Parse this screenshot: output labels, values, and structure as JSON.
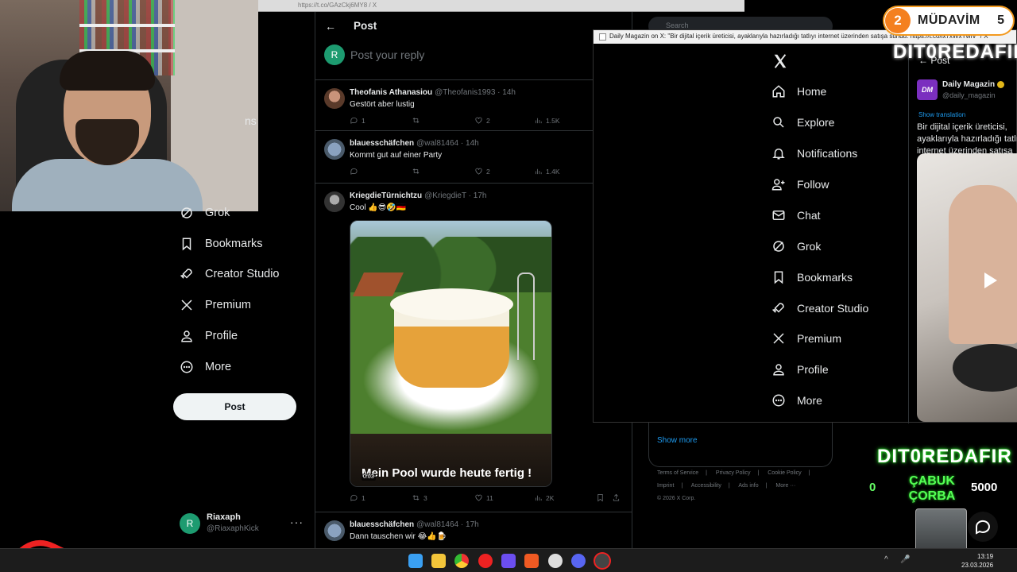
{
  "browser": {
    "url": "https://t.co/GAzCkj6MY8 / X"
  },
  "left_nav": {
    "partial_item": "ns",
    "items": [
      {
        "label": "Grok",
        "icon": "grok-icon"
      },
      {
        "label": "Bookmarks",
        "icon": "bookmark-icon"
      },
      {
        "label": "Creator Studio",
        "icon": "rocket-icon"
      },
      {
        "label": "Premium",
        "icon": "x-logo-icon"
      },
      {
        "label": "Profile",
        "icon": "person-icon"
      },
      {
        "label": "More",
        "icon": "more-circle-icon"
      }
    ],
    "post_button": "Post",
    "account": {
      "avatar_letter": "R",
      "name": "Riaxaph",
      "handle": "@RiaxaphKick",
      "more": "···"
    }
  },
  "timeline": {
    "back": "←",
    "title": "Post",
    "reply": {
      "avatar_letter": "R",
      "placeholder": "Post your reply"
    },
    "tweets": [
      {
        "name": "Theofanis Athanasiou",
        "meta": "@Theofanis1993 · 14h",
        "text": "Gestört aber lustig",
        "replies": "1",
        "retweets": "",
        "likes": "2",
        "views": "1.5K"
      },
      {
        "name": "blauesschäfchen",
        "meta": "@wal81464 · 14h",
        "text": "Kommt gut auf einer Party",
        "replies": "",
        "retweets": "",
        "likes": "2",
        "views": "1.4K"
      },
      {
        "name": "KriegdieTürnichtzu",
        "meta": "@KriegdieT · 17h",
        "text": "Cool 👍😎🤣🇩🇪",
        "media_caption": "Mein Pool wurde heute fertig !",
        "media_time": "0:03",
        "replies": "1",
        "retweets": "3",
        "likes": "11",
        "views": "2K"
      },
      {
        "name": "blauesschäfchen",
        "meta": "@wal81464 · 17h",
        "text": "Dann tauschen wir 😂👍🍺"
      }
    ]
  },
  "right_col": {
    "search_placeholder": "Search",
    "show_more": "Show more",
    "footer": [
      "Terms of Service",
      "|",
      "Privacy Policy",
      "|",
      "Cookie Policy",
      "|",
      "Imprint",
      "|",
      "Accessibility",
      "|",
      "Ads info",
      "|",
      "More ···",
      "© 2026 X Corp."
    ]
  },
  "popup": {
    "title": "Daily Magazin on X: \"Bir dijital içerik üreticisi, ayaklarıyla hazırladığı tatlıyı internet üzerinden satışa sundu. https://t.co/ix7xWxYwiV\" / X",
    "nav": [
      {
        "label": "Home",
        "icon": "home-icon"
      },
      {
        "label": "Explore",
        "icon": "search-icon"
      },
      {
        "label": "Notifications",
        "icon": "bell-icon"
      },
      {
        "label": "Follow",
        "icon": "person-add-icon"
      },
      {
        "label": "Chat",
        "icon": "mail-icon"
      },
      {
        "label": "Grok",
        "icon": "grok-icon"
      },
      {
        "label": "Bookmarks",
        "icon": "bookmark-icon"
      },
      {
        "label": "Creator Studio",
        "icon": "rocket-icon"
      },
      {
        "label": "Premium",
        "icon": "x-logo-icon"
      },
      {
        "label": "Profile",
        "icon": "person-icon"
      },
      {
        "label": "More",
        "icon": "more-circle-icon"
      }
    ],
    "post_back": "← Post",
    "author_logo": "DM",
    "author_name": "Daily Magazin",
    "author_handle": "@daily_magazin",
    "show_translation": "Show translation",
    "text": "Bir dijital içerik üreticisi, ayaklarıyla hazırladığı tatlıyı internet üzerinden satışa sundu."
  },
  "overlays": {
    "badge_level": "2",
    "badge_label": "MÜDAVİM",
    "badge_count": "5",
    "neon_text": "DIT0REDAFIR",
    "corba_left": "0",
    "corba": "ÇABUK ÇORBA",
    "corba_right": "5000"
  },
  "taskbar": {
    "time": "13:19",
    "date": "23.03.2026"
  },
  "colors": {
    "accent": "#1d9bf0",
    "badge_orange": "#f4801f",
    "neon_green": "#5f5"
  }
}
